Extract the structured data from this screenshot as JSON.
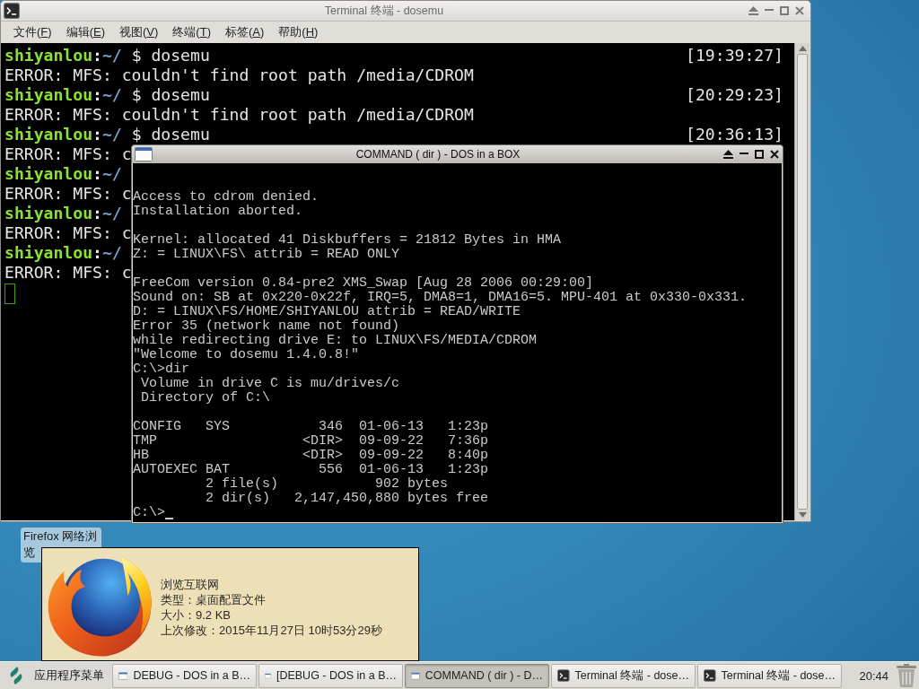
{
  "terminal_window": {
    "title": "Terminal 终端 - dosemu",
    "menu": [
      "文件(F)",
      "编辑(E)",
      "视图(V)",
      "终端(T)",
      "标签(A)",
      "帮助(H)"
    ],
    "lines": [
      {
        "kind": "prompt",
        "user": "shiyanlou",
        "separator": ":",
        "path": "~/",
        "command": "$ dosemu",
        "time": "[19:39:27]"
      },
      {
        "kind": "error",
        "text": "ERROR: MFS: couldn't find root path /media/CDROM"
      },
      {
        "kind": "prompt",
        "user": "shiyanlou",
        "separator": ":",
        "path": "~/",
        "command": "$ dosemu",
        "time": "[20:29:23]"
      },
      {
        "kind": "error",
        "text": "ERROR: MFS: couldn't find root path /media/CDROM"
      },
      {
        "kind": "prompt",
        "user": "shiyanlou",
        "separator": ":",
        "path": "~/",
        "command": "$ dosemu",
        "time": "[20:36:13]"
      },
      {
        "kind": "error",
        "text": "ERROR: MFS: c"
      },
      {
        "kind": "prompt",
        "user": "shiyanlou",
        "separator": ":",
        "path": "~/"
      },
      {
        "kind": "error",
        "text": "ERROR: MFS: c"
      },
      {
        "kind": "prompt",
        "user": "shiyanlou",
        "separator": ":",
        "path": "~/"
      },
      {
        "kind": "error",
        "text": "ERROR: MFS: c"
      },
      {
        "kind": "prompt",
        "user": "shiyanlou",
        "separator": ":",
        "path": "~/"
      },
      {
        "kind": "error",
        "text": "ERROR: MFS: c"
      },
      {
        "kind": "cursor"
      }
    ]
  },
  "dos_window": {
    "title": "COMMAND ( dir ) - DOS in a BOX",
    "blocks": [
      [
        "Access to cdrom denied.",
        "Installation aborted."
      ],
      [
        "Kernel: allocated 41 Diskbuffers = 21812 Bytes in HMA",
        "Z: = LINUX\\FS\\ attrib = READ ONLY"
      ],
      [
        "FreeCom version 0.84-pre2 XMS_Swap [Aug 28 2006 00:29:00]",
        "Sound on: SB at 0x220-0x22f, IRQ=5, DMA8=1, DMA16=5. MPU-401 at 0x330-0x331.",
        "D: = LINUX\\FS/HOME/SHIYANLOU attrib = READ/WRITE",
        "Error 35 (network name not found)",
        "while redirecting drive E: to LINUX\\FS/MEDIA/CDROM",
        "\"Welcome to dosemu 1.4.0.8!\"",
        "C:\\>dir",
        " Volume in drive C is mu/drives/c",
        " Directory of C:\\"
      ],
      [
        "CONFIG   SYS           346  01-06-13   1:23p",
        "TMP                  <DIR>  09-09-22   7:36p",
        "HB                   <DIR>  09-09-22   8:40p",
        "AUTOEXEC BAT           556  01-06-13   1:23p",
        "         2 file(s)            902 bytes",
        "         2 dir(s)   2,147,450,880 bytes free"
      ]
    ],
    "prompt": "C:\\>"
  },
  "desktop_icon": {
    "label": "Firefox 网络浏览",
    "selected": true
  },
  "tooltip": {
    "lines": [
      "浏览互联网",
      "类型：桌面配置文件",
      "大小：9.2 KB",
      "上次修改：2015年11月27日 10时53分29秒"
    ]
  },
  "taskbar": {
    "menu_label": "应用程序菜单",
    "tasks": [
      {
        "kind": "dos",
        "label": "DEBUG - DOS in a B…",
        "selected": false
      },
      {
        "kind": "dos",
        "label": "[DEBUG - DOS in a B…",
        "selected": false
      },
      {
        "kind": "dos",
        "label": "COMMAND ( dir ) - D…",
        "selected": true
      },
      {
        "kind": "terminal",
        "label": "Terminal 终端 - dose…",
        "selected": false
      },
      {
        "kind": "terminal",
        "label": "Terminal 终端 - dose…",
        "selected": false
      }
    ],
    "clock": "20:44"
  }
}
